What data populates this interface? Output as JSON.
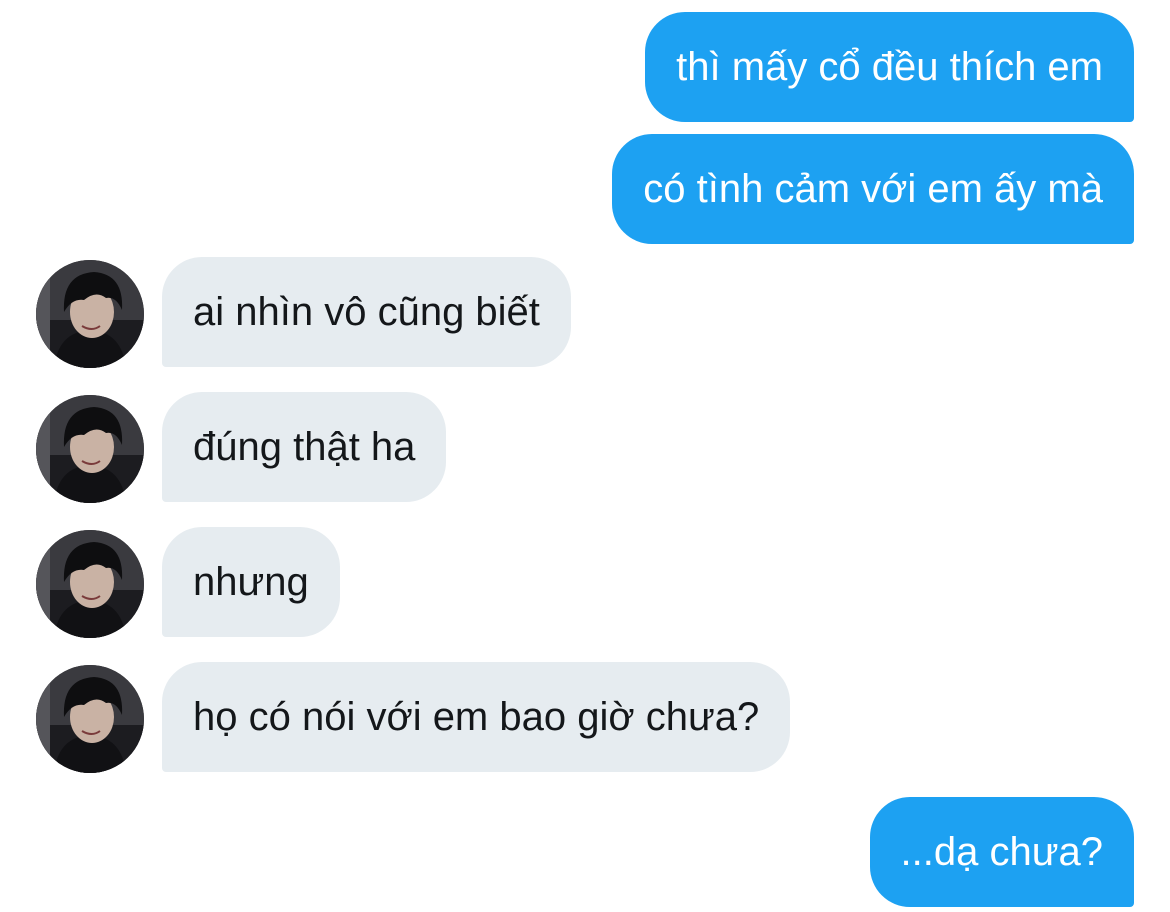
{
  "conversation": {
    "messages": [
      {
        "sender": "me",
        "text": "thì mấy cổ đều thích em"
      },
      {
        "sender": "me",
        "text": "có tình cảm với em ấy mà"
      },
      {
        "sender": "them",
        "text": "ai nhìn vô cũng biết"
      },
      {
        "sender": "them",
        "text": "đúng thật ha"
      },
      {
        "sender": "them",
        "text": "nhưng"
      },
      {
        "sender": "them",
        "text": "họ có nói với em bao giờ chưa?"
      },
      {
        "sender": "me",
        "text": "...dạ chưa?"
      }
    ]
  },
  "colors": {
    "sent_bubble": "#1da1f2",
    "received_bubble": "#e6ecf0",
    "sent_text": "#ffffff",
    "received_text": "#14171a"
  },
  "icons": {
    "contact_avatar": "avatar-photo"
  }
}
